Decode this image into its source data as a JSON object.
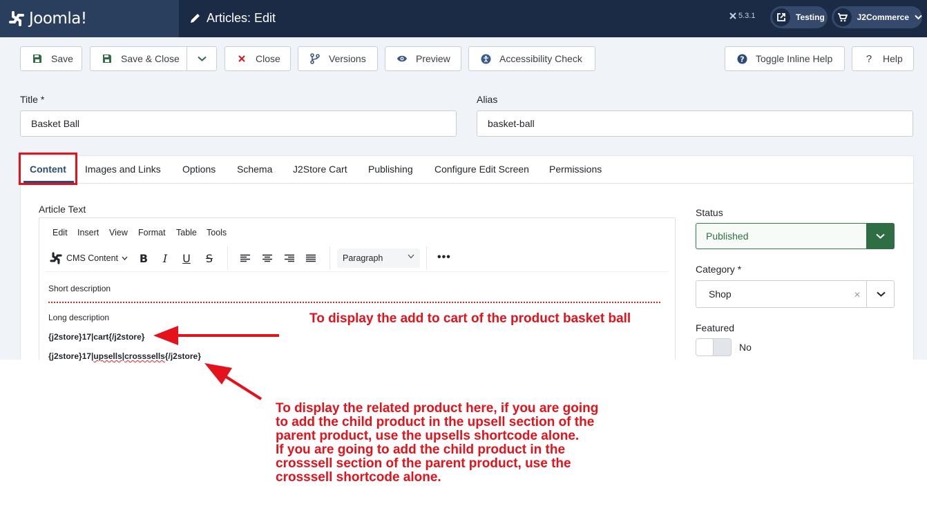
{
  "header": {
    "brand": "Joomla!",
    "page_title": "Articles: Edit",
    "version": "5.3.1",
    "site_link": "Testing",
    "user_menu": "J2Commerce"
  },
  "toolbar": {
    "save": "Save",
    "save_close": "Save & Close",
    "close": "Close",
    "versions": "Versions",
    "preview": "Preview",
    "accessibility": "Accessibility Check",
    "inline_help": "Toggle Inline Help",
    "help": "Help"
  },
  "form": {
    "title_label": "Title *",
    "title_value": "Basket Ball",
    "alias_label": "Alias",
    "alias_value": "basket-ball"
  },
  "tabs": [
    "Content",
    "Images and Links",
    "Options",
    "Schema",
    "J2Store Cart",
    "Publishing",
    "Configure Edit Screen",
    "Permissions"
  ],
  "editor": {
    "label": "Article Text",
    "menu": [
      "Edit",
      "Insert",
      "View",
      "Format",
      "Table",
      "Tools"
    ],
    "cms_content": "CMS Content",
    "paragraph": "Paragraph",
    "short_description": "Short description",
    "long_description": "Long description",
    "code_cart": "{j2store}17|cart{/j2store}",
    "code_related_a": "{j2store}17|",
    "code_related_b": "upsells",
    "code_related_c": "|",
    "code_related_d": "crosssells",
    "code_related_e": "{/j2store}"
  },
  "sidebar": {
    "status_label": "Status",
    "status_value": "Published",
    "category_label": "Category *",
    "category_value": "Shop",
    "featured_label": "Featured",
    "featured_value": "No"
  },
  "annotations": {
    "cart": "To display the add to cart of the product basket ball",
    "related": "To display the related product here, if you are going\nto add the child product in the upsell section of the\nparent product, use the upsells shortcode alone.\nIf you are going to add the child product in the\ncrosssell section of the parent product, use the\ncrosssell shortcode alone."
  },
  "colors": {
    "header_bg": "#1c2b45",
    "accent": "#2c4b7a",
    "status_green": "#2f6d45",
    "annotation_red": "#e3121b"
  }
}
